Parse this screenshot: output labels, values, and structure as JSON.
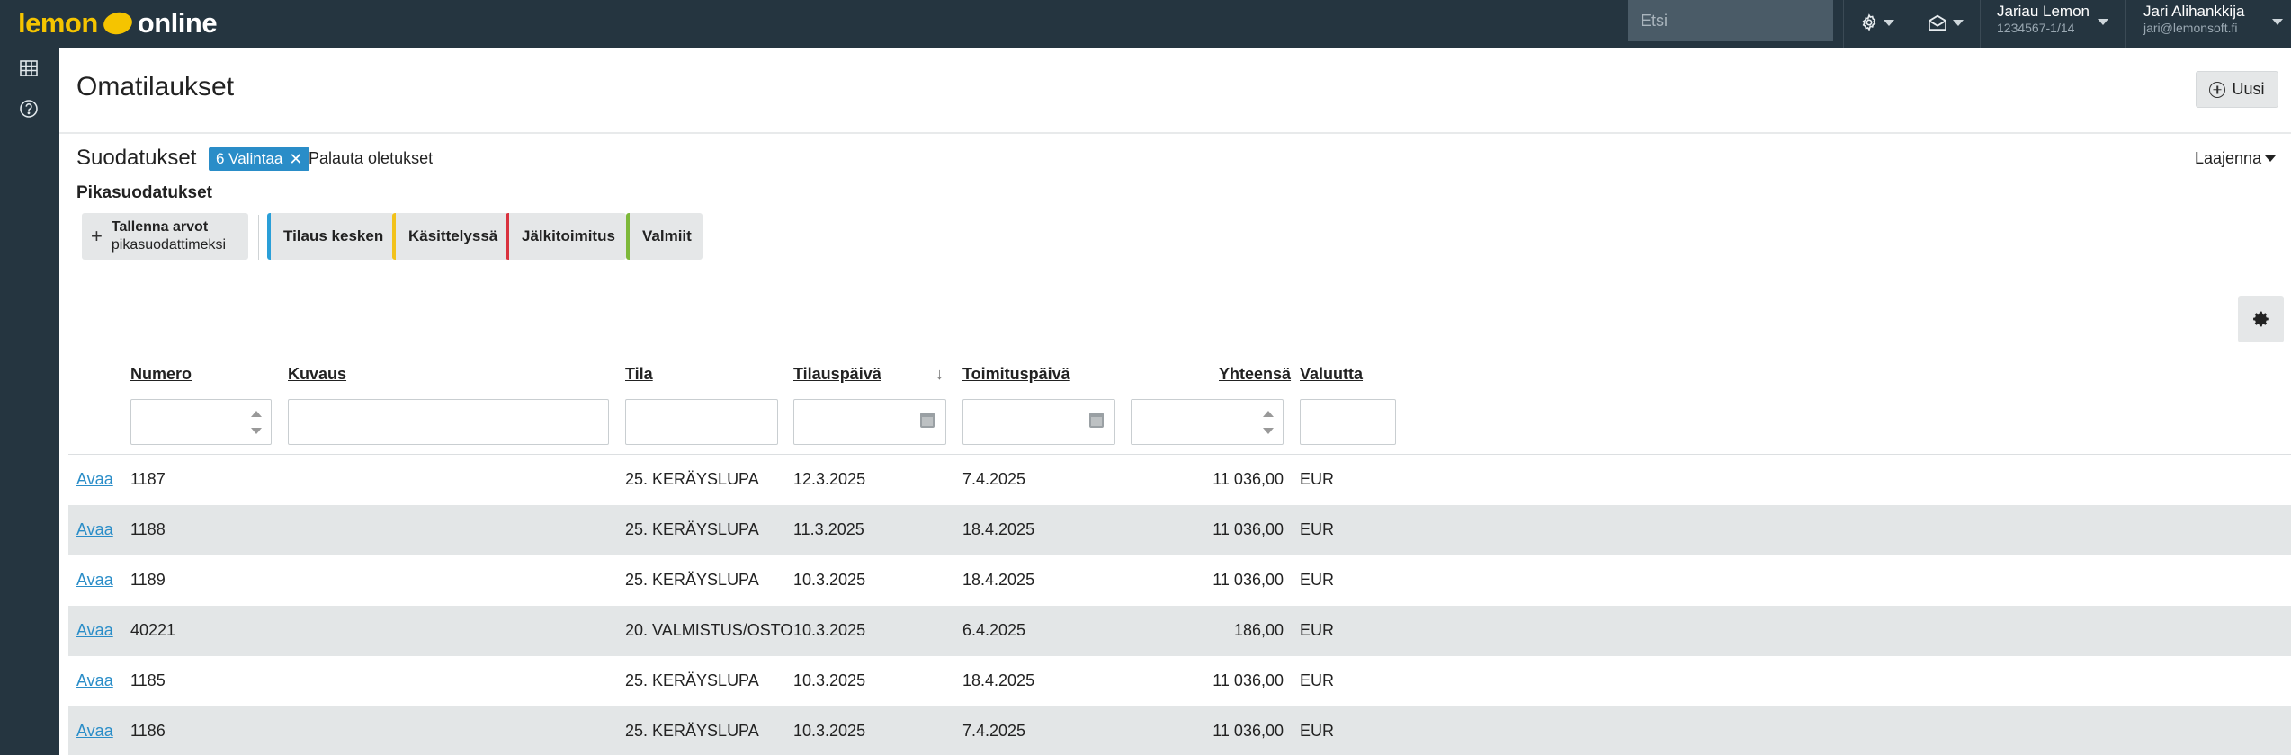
{
  "header": {
    "logo_lemon": "lemon",
    "logo_online": "online",
    "search_placeholder": "Etsi",
    "company": {
      "name": "Jariau Lemon",
      "sub": "1234567-1/14"
    },
    "user": {
      "name": "Jari Alihankkija",
      "email": "jari@lemonsoft.fi"
    }
  },
  "page": {
    "title": "Omatilaukset",
    "new_label": "Uusi"
  },
  "filters": {
    "title": "Suodatukset",
    "chip_label": "6 Valintaa",
    "reset_label": "Palauta oletukset",
    "expand_label": "Laajenna",
    "quick_title": "Pikasuodatukset",
    "save_line1": "Tallenna arvot",
    "save_line2": "pikasuodattimeksi",
    "quick": [
      {
        "label": "Tilaus kesken",
        "color": "#2a9fd8"
      },
      {
        "label": "Käsittelyssä",
        "color": "#f2c21b"
      },
      {
        "label": "Jälkitoimitus",
        "color": "#d9323e"
      },
      {
        "label": "Valmiit",
        "color": "#7db83a"
      }
    ]
  },
  "table": {
    "columns": {
      "numero": "Numero",
      "kuvaus": "Kuvaus",
      "tila": "Tila",
      "tilauspaiva": "Tilauspäivä",
      "toimituspaiva": "Toimituspäivä",
      "yhteensa": "Yhteensä",
      "valuutta": "Valuutta"
    },
    "sort_arrow": "↓",
    "open_label": "Avaa",
    "rows": [
      {
        "numero": "1187",
        "kuvaus": "",
        "tila": "25. KERÄYSLUPA",
        "tilauspaiva": "12.3.2025",
        "toimituspaiva": "7.4.2025",
        "yhteensa": "11 036,00",
        "valuutta": "EUR"
      },
      {
        "numero": "1188",
        "kuvaus": "",
        "tila": "25. KERÄYSLUPA",
        "tilauspaiva": "11.3.2025",
        "toimituspaiva": "18.4.2025",
        "yhteensa": "11 036,00",
        "valuutta": "EUR"
      },
      {
        "numero": "1189",
        "kuvaus": "",
        "tila": "25. KERÄYSLUPA",
        "tilauspaiva": "10.3.2025",
        "toimituspaiva": "18.4.2025",
        "yhteensa": "11 036,00",
        "valuutta": "EUR"
      },
      {
        "numero": "40221",
        "kuvaus": "",
        "tila": "20. VALMISTUS/OSTO",
        "tilauspaiva": "10.3.2025",
        "toimituspaiva": "6.4.2025",
        "yhteensa": "186,00",
        "valuutta": "EUR"
      },
      {
        "numero": "1185",
        "kuvaus": "",
        "tila": "25. KERÄYSLUPA",
        "tilauspaiva": "10.3.2025",
        "toimituspaiva": "18.4.2025",
        "yhteensa": "11 036,00",
        "valuutta": "EUR"
      },
      {
        "numero": "1186",
        "kuvaus": "",
        "tila": "25. KERÄYSLUPA",
        "tilauspaiva": "10.3.2025",
        "toimituspaiva": "7.4.2025",
        "yhteensa": "11 036,00",
        "valuutta": "EUR"
      }
    ]
  }
}
